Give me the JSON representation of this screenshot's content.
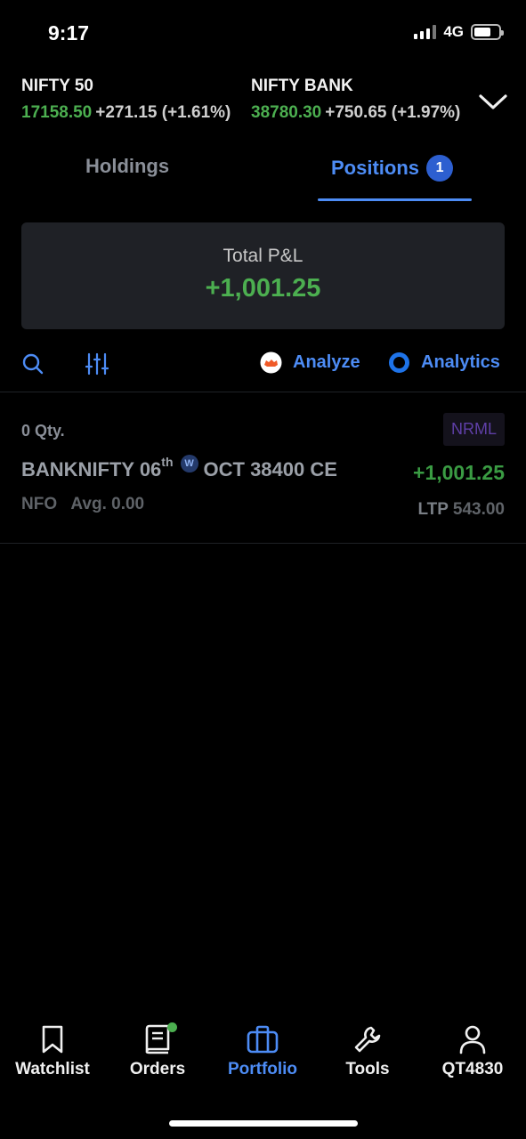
{
  "status_bar": {
    "time": "9:17",
    "network": "4G"
  },
  "indices": [
    {
      "name": "NIFTY 50",
      "price": "17158.50",
      "change": "+271.15 (+1.61%)"
    },
    {
      "name": "NIFTY BANK",
      "price": "38780.30",
      "change": "+750.65 (+1.97%)"
    }
  ],
  "tabs": {
    "holdings": "Holdings",
    "positions": "Positions",
    "positions_count": "1"
  },
  "summary": {
    "label": "Total P&L",
    "value": "+1,001.25"
  },
  "toolbar": {
    "analyze": "Analyze",
    "analytics": "Analytics"
  },
  "position": {
    "qty": "0 Qty.",
    "product": "NRML",
    "underlying": "BANKNIFTY 06",
    "day_suffix": "th",
    "weekly_tag": "W",
    "contract": "OCT 38400 CE",
    "pnl": "+1,001.25",
    "exchange": "NFO",
    "avg_label": "Avg.",
    "avg_value": "0.00",
    "ltp_label": "LTP",
    "ltp_value": "543.00"
  },
  "nav": [
    {
      "label": "Watchlist",
      "icon": "bookmark-icon"
    },
    {
      "label": "Orders",
      "icon": "book-icon"
    },
    {
      "label": "Portfolio",
      "icon": "briefcase-icon"
    },
    {
      "label": "Tools",
      "icon": "wrench-icon"
    },
    {
      "label": "QT4830",
      "icon": "user-icon"
    }
  ],
  "colors": {
    "accent": "#4d8cf5",
    "profit": "#4caf50",
    "background": "#000000"
  }
}
